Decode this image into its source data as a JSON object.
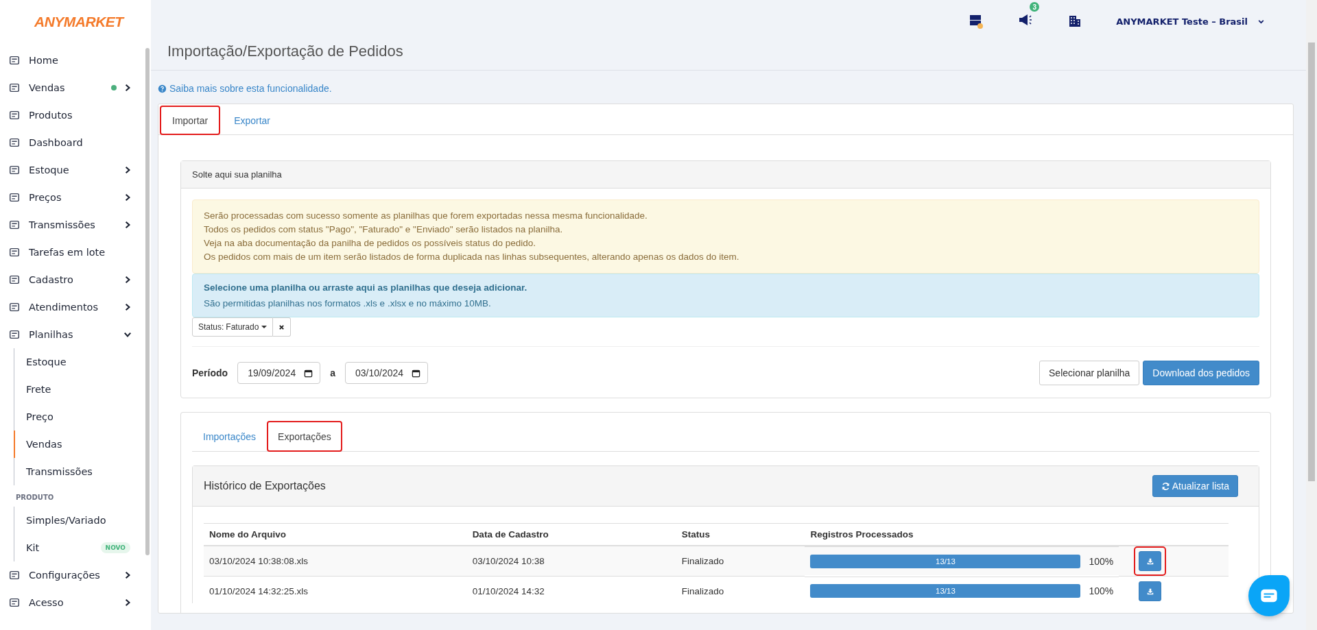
{
  "brand": {
    "logo": "ANYMARKET"
  },
  "sidebar": {
    "items": [
      {
        "label": "Home"
      },
      {
        "label": "Vendas",
        "expanded": false,
        "color": "#4caf7d"
      },
      {
        "label": "Produtos"
      },
      {
        "label": "Dashboard"
      },
      {
        "label": "Estoque",
        "expanded": false
      },
      {
        "label": "Preços",
        "expanded": false
      },
      {
        "label": "Transmissões",
        "expanded": false
      },
      {
        "label": "Tarefas em lote"
      },
      {
        "label": "Cadastro",
        "expanded": false
      },
      {
        "label": "Atendimentos",
        "expanded": false
      },
      {
        "label": "Planilhas",
        "expanded": true,
        "children": [
          {
            "label": "Estoque",
            "selected": false
          },
          {
            "label": "Frete",
            "selected": false
          },
          {
            "label": "Preço",
            "selected": false
          },
          {
            "label": "Vendas",
            "selected": true
          },
          {
            "label": "Transmissões",
            "selected": false
          }
        ],
        "sections": [
          {
            "heading": "PRODUTO",
            "children": [
              {
                "label": "Simples/Variado",
                "selected": false
              },
              {
                "label": "Kit",
                "selected": false,
                "badge": "NOVO"
              }
            ]
          }
        ]
      },
      {
        "label": "Configurações",
        "expanded": false
      },
      {
        "label": "Acesso",
        "expanded": false
      }
    ]
  },
  "topbar": {
    "notification_count": "3",
    "account": "ANYMARKET Teste – Brasil"
  },
  "page": {
    "title": "Importação/Exportação de Pedidos",
    "help_link": "Saiba mais sobre esta funcionalidade."
  },
  "tabs": [
    {
      "label": "Importar",
      "selected": true,
      "highlighted": true
    },
    {
      "label": "Exportar",
      "selected": false,
      "highlighted": false
    }
  ],
  "import_panel": {
    "heading": "Solte aqui sua planilha",
    "notice_lines": [
      "Serão processadas com sucesso somente as planilhas que forem exportadas nessa mesma funcionalidade.",
      "Todos os pedidos com status \"Pago\", \"Faturado\" e \"Enviado\" serão listados na planilha.",
      "Veja na aba documentação da panilha de pedidos os possíveis status do pedido.",
      "Os pedidos com mais de um item serão listados de forma duplicada nas linhas subsequentes, alterando apenas os dados do item."
    ],
    "dropzone": {
      "title": "Selecione uma planilha ou arraste aqui as planilhas que deseja adicionar.",
      "hint": "São permitidas planilhas nos formatos .xls e .xlsx e no máximo 10MB."
    },
    "filter": {
      "label": "Status:",
      "value": "Faturado"
    },
    "period": {
      "label": "Período",
      "from": "19/09/2024",
      "separator": "a",
      "to": "03/10/2024"
    },
    "buttons": [
      {
        "label": "Selecionar planilha",
        "kind": "default"
      },
      {
        "label": "Download dos pedidos",
        "kind": "primary"
      }
    ]
  },
  "sub_tabs": [
    {
      "label": "Importações",
      "selected": false,
      "highlighted": false
    },
    {
      "label": "Exportações",
      "selected": true,
      "highlighted": true
    }
  ],
  "history": {
    "title": "Histórico de Exportações",
    "refresh_button": "Atualizar lista",
    "columns": [
      "Nome do Arquivo",
      "Data de Cadastro",
      "Status",
      "Registros Processados"
    ],
    "rows": [
      {
        "file": "03/10/2024 10:38:08.xls",
        "date": "03/10/2024 10:38",
        "status": "Finalizado",
        "progress": "13/13",
        "level": 1,
        "percent": "100%",
        "highlighted": true
      },
      {
        "file": "01/10/2024 14:32:25.xls",
        "date": "01/10/2024 14:32",
        "status": "Finalizado",
        "progress": "13/13",
        "level": 1,
        "percent": "100%",
        "highlighted": false
      }
    ]
  }
}
